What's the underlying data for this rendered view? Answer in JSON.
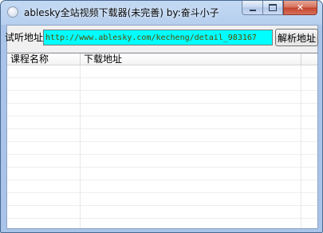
{
  "window": {
    "title": "ablesky全站视频下载器(未完善) by:奋斗小子"
  },
  "form": {
    "url_label": "试听地址",
    "url_value": "http://www.ablesky.com/kecheng/detail_983167",
    "parse_button": "解析地址",
    "input_bg_color": "#00ffff"
  },
  "list": {
    "columns": [
      "课程名称",
      "下载地址",
      ""
    ],
    "rows": []
  },
  "icons": {
    "app": "app-icon",
    "minimize": "minimize-icon",
    "maximize": "maximize-icon",
    "close": "close-icon"
  }
}
